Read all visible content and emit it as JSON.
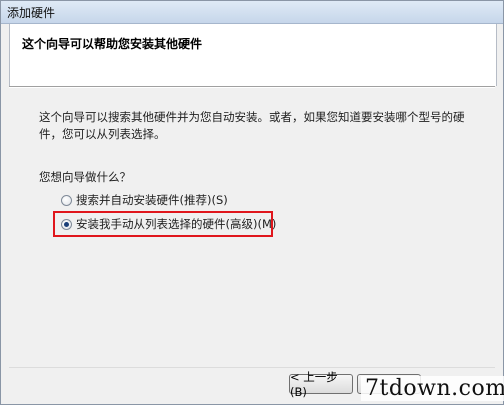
{
  "window": {
    "title": "添加硬件"
  },
  "header": {
    "title": "这个向导可以帮助您安装其他硬件"
  },
  "body": {
    "description": "这个向导可以搜索其他硬件并为您自动安装。或者，如果您知道要安装哪个型号的硬件，您可以从列表选择。",
    "question": "您想向导做什么？",
    "options": [
      {
        "label": "搜索并自动安装硬件(推荐)(S)",
        "selected": false
      },
      {
        "label": "安装我手动从列表选择的硬件(高级)(M)",
        "selected": true
      }
    ]
  },
  "footer": {
    "back_label": "< 上一步(B)",
    "next_label": ""
  },
  "watermark": "7tdown.com",
  "colors": {
    "highlight": "#e0161c",
    "titlebar": "#c6d6ea"
  }
}
